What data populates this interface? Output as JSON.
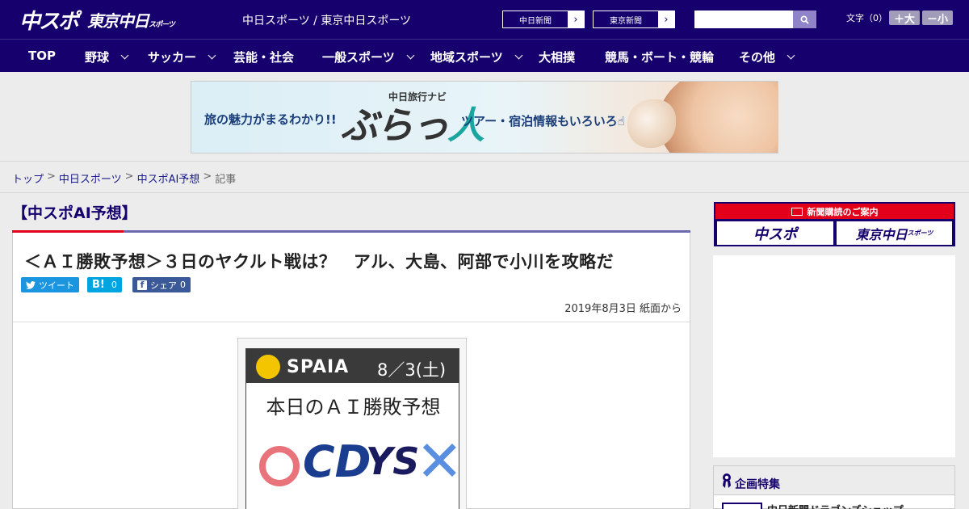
{
  "header": {
    "logo_main": "中スポ",
    "logo_sub": "東京中日",
    "logo_sub_small": "スポーツ",
    "site_links": "中日スポーツ / 東京中日スポーツ",
    "btn_chunichi": "中日新聞",
    "btn_tokyo": "東京新聞",
    "text_size_label": "文字（0）",
    "size_up": "＋大",
    "size_down": "－小"
  },
  "nav": {
    "items": [
      "TOP",
      "野球",
      "サッカー",
      "芸能・社会",
      "一般スポーツ",
      "地域スポーツ",
      "大相撲",
      "競馬・ボート・競輪",
      "その他"
    ]
  },
  "banner": {
    "left_text": "旅の魅力がまるわかり!!",
    "sub": "中日旅行ナビ",
    "logo_a": "ぶらっ",
    "logo_b": "人",
    "right_text": "ツアー・宿泊情報もいろいろ☝"
  },
  "breadcrumb": {
    "items": [
      "トップ",
      "中日スポーツ",
      "中スポAI予想"
    ],
    "current": "記事",
    "sep": ">"
  },
  "article": {
    "section": "【中スポAI予想】",
    "headline": "＜ＡＩ勝敗予想＞３日のヤクルト戦は？　アル、大島、阿部で小川を攻略だ",
    "tweet": "ツイート",
    "hatena": "B!",
    "hatena_count": "0",
    "facebook": "シェア",
    "facebook_count": "0",
    "dateline": "2019年8月3日 紙面から"
  },
  "figure": {
    "brand": "SPAIA",
    "date": "8／3(土)",
    "title": "本日のＡＩ勝敗予想",
    "win_mark": "○",
    "lose_mark": "✕",
    "team_home": "CD",
    "team_away": "YS"
  },
  "sidebar": {
    "subscribe": "新聞購読のご案内",
    "logo_chuspo": "中スポ",
    "logo_tokyo": "東京中日",
    "logo_tokyo_small": "スポーツ",
    "feature_title": "企画特集",
    "feature_item": "中日新聞ドラゴンズショップ"
  }
}
